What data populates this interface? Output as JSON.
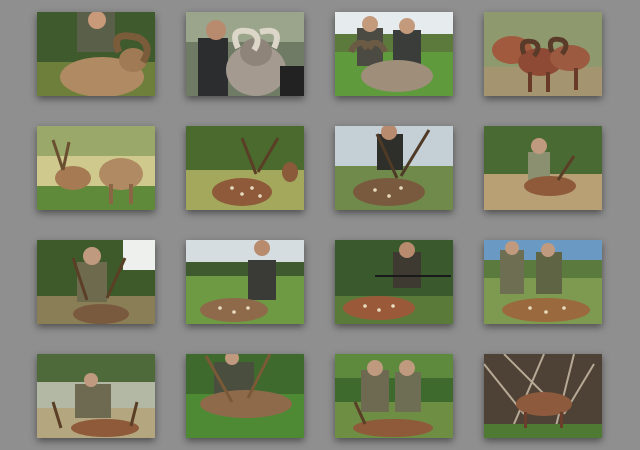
{
  "gallery": {
    "photos": [
      {
        "subject": "hunter-with-ram"
      },
      {
        "subject": "hunter-with-ram"
      },
      {
        "subject": "two-hunters-with-ram"
      },
      {
        "subject": "red-sheep-herd"
      },
      {
        "subject": "axis-deer-pair"
      },
      {
        "subject": "axis-deer-buck"
      },
      {
        "subject": "hunter-with-axis-buck"
      },
      {
        "subject": "hunter-with-axis-deer"
      },
      {
        "subject": "hunter-with-axis-buck"
      },
      {
        "subject": "hunter-with-axis-deer"
      },
      {
        "subject": "hunter-with-axis-deer"
      },
      {
        "subject": "two-hunters-with-axis-deer"
      },
      {
        "subject": "hunter-with-axis-buck"
      },
      {
        "subject": "hunter-with-axis-buck"
      },
      {
        "subject": "two-hunters-with-axis-buck"
      },
      {
        "subject": "sheep-in-brush"
      }
    ]
  }
}
